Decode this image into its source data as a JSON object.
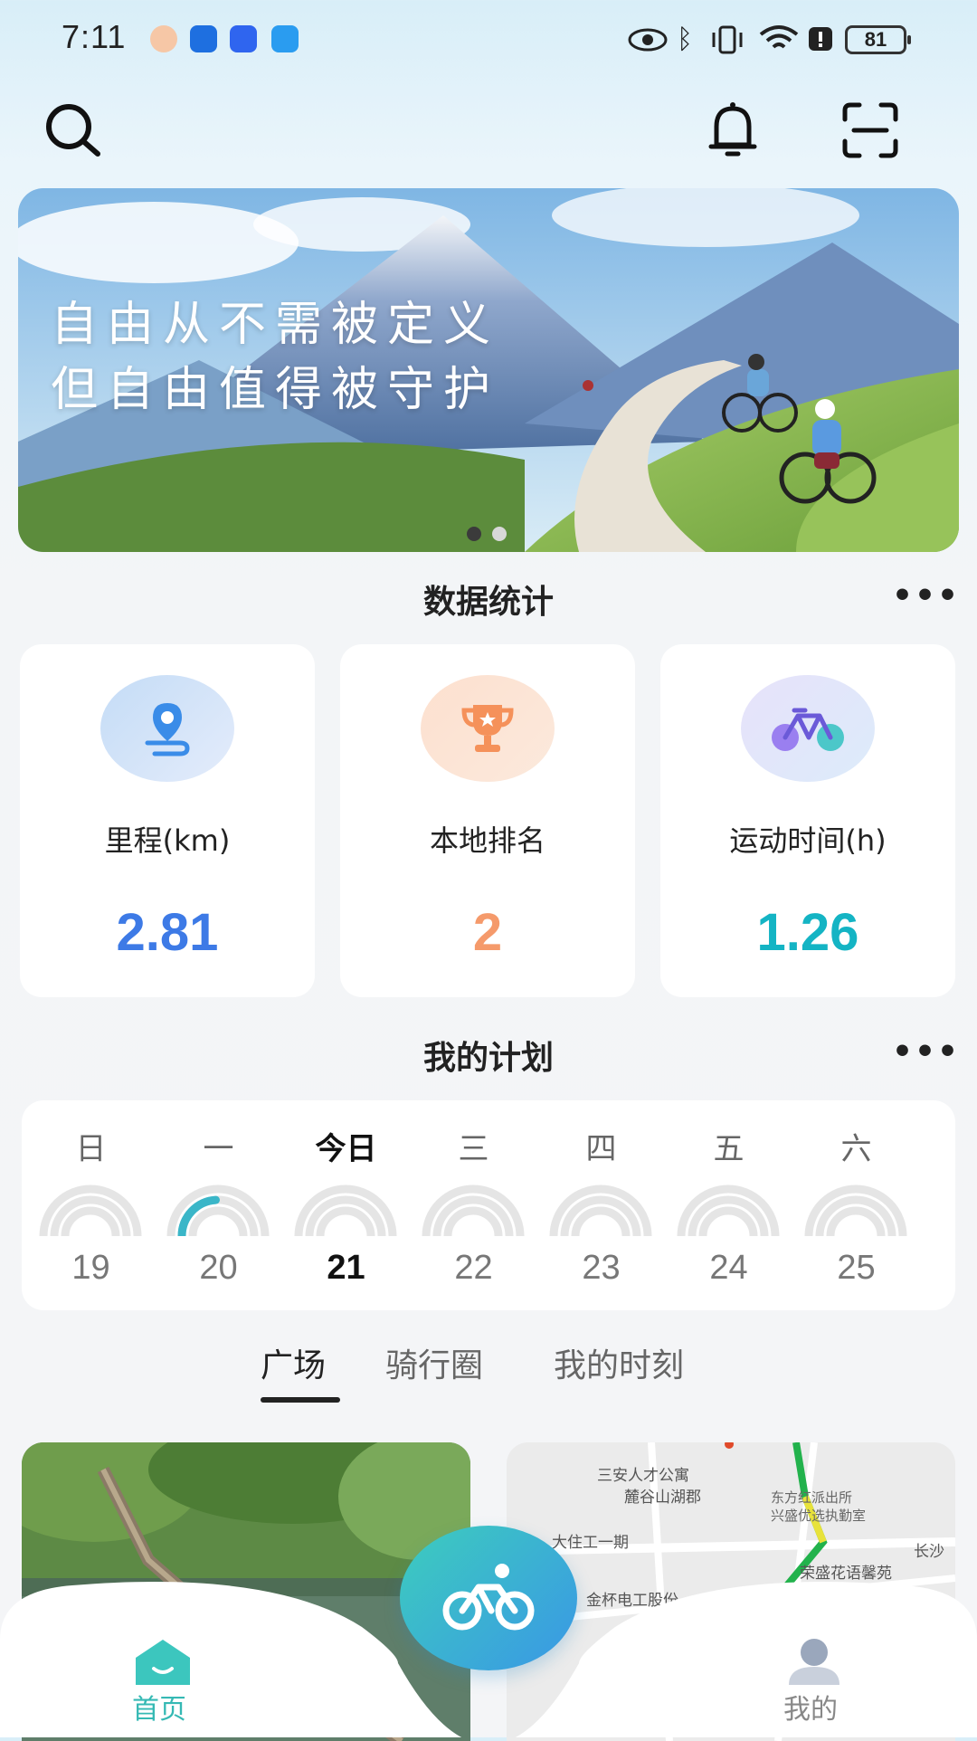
{
  "status_bar": {
    "time": "7:11",
    "battery": "81"
  },
  "banner": {
    "line1": "自由从不需被定义",
    "line2": "但自由值得被守护"
  },
  "stats": {
    "title": "数据统计",
    "more": "•••",
    "items": [
      {
        "label": "里程(km)",
        "value": "2.81",
        "icon": "location-route-icon",
        "color": "#3d7ae6"
      },
      {
        "label": "本地排名",
        "value": "2",
        "icon": "trophy-icon",
        "color": "#f59a6b"
      },
      {
        "label": "运动时间(h)",
        "value": "1.26",
        "icon": "bicycle-icon",
        "color": "#14b4c4"
      }
    ]
  },
  "plan": {
    "title": "我的计划",
    "more": "•••",
    "days": [
      {
        "name": "日",
        "num": "19",
        "progress": 0
      },
      {
        "name": "一",
        "num": "20",
        "progress": 0.3
      },
      {
        "name": "今日",
        "num": "21",
        "progress": 0,
        "today": true
      },
      {
        "name": "三",
        "num": "22",
        "progress": 0
      },
      {
        "name": "四",
        "num": "23",
        "progress": 0
      },
      {
        "name": "五",
        "num": "24",
        "progress": 0
      },
      {
        "name": "六",
        "num": "25",
        "progress": 0
      }
    ]
  },
  "tabs": [
    "广场",
    "骑行圈",
    "我的时刻"
  ],
  "map_labels": {
    "a": "三安人才公寓",
    "b": "麓谷山湖郡",
    "c": "东方红派出所",
    "d": "兴盛优选执勤室",
    "e": "大住工一期",
    "f": "荣盛花语馨苑",
    "g": "金杯电工股份",
    "h": "长沙"
  },
  "nav": {
    "home": "首页",
    "mine": "我的"
  },
  "colors": {
    "accent_teal": "#3ccdbd",
    "accent_blue": "#3a97e6"
  }
}
